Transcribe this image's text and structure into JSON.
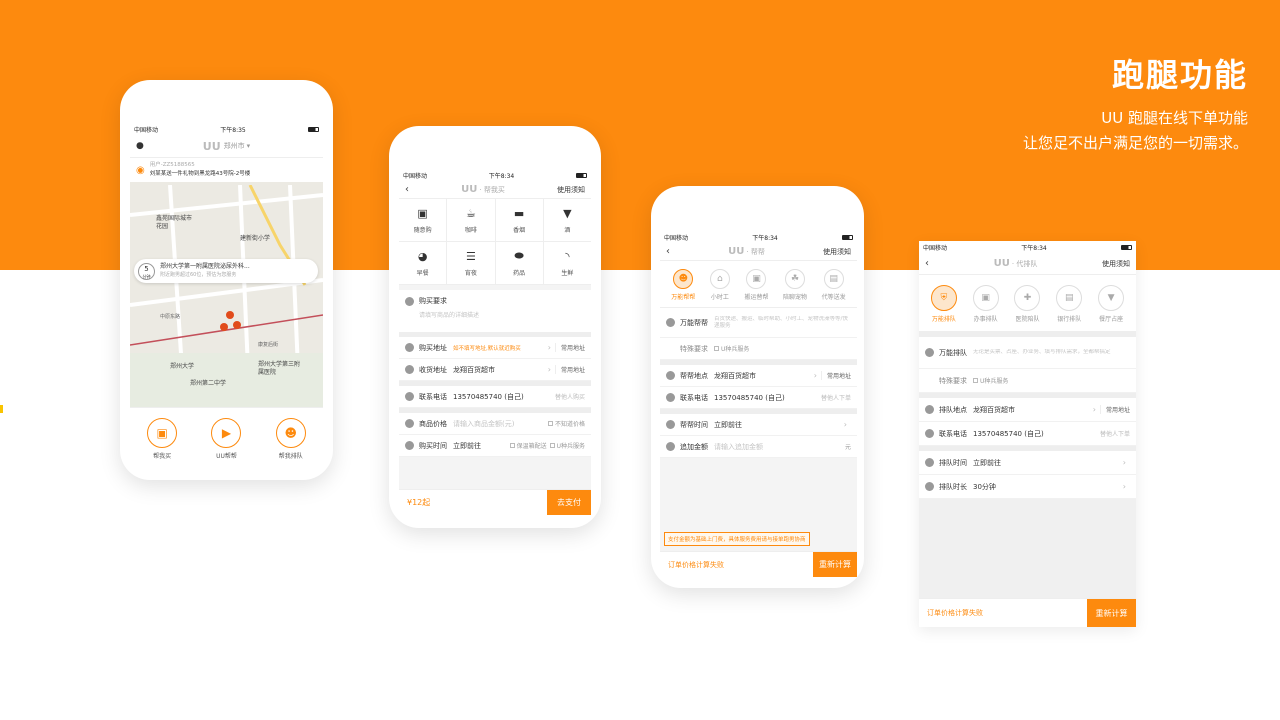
{
  "header": {
    "title": "跑腿功能",
    "line1": "UU 跑腿在线下单功能",
    "line2": "让您足不出户满足您的一切需求。"
  },
  "status": {
    "carrier": "中国移动",
    "time1": "下午8:35",
    "time2": "下午8:34",
    "time3": "下午8:34",
    "time4": "下午8:34"
  },
  "phone1": {
    "logo": "UU",
    "city": "郑州市",
    "user": "用户-ZZ5188565",
    "notice": "刘某某送一件礼物到黑龙路43号院-2号楼",
    "map_labels": [
      "鑫苑国际城市花园",
      "建新街小学",
      "郑州大学第一附属医院",
      "郑州大学",
      "郑州第二中学",
      "郑州大学第三附属医院",
      "中原东路",
      "康复后街"
    ],
    "eta_num": "5",
    "eta_unit": "分钟",
    "dest": "郑州大学第一附属医院泌尿外科...",
    "dest_sub": "附近跑男超过60位，预估为您服务",
    "tabs": [
      "帮我买",
      "UU帮帮",
      "帮我排队"
    ]
  },
  "phone2": {
    "title": "帮我买",
    "help": "使用须知",
    "cats": [
      "随意购",
      "咖啡",
      "香烟",
      "酒",
      "早餐",
      "宵夜",
      "药品",
      "生鲜"
    ],
    "req_label": "购买要求",
    "req_ph": "请填写商品的详细描述",
    "buy_addr_label": "购买地址",
    "buy_addr_val": "如不填写地址,默认就近购买",
    "common1": "常用地址",
    "recv_label": "收货地址",
    "recv_val": "龙翔百货超市",
    "common2": "常用地址",
    "phone_label": "联系电话",
    "phone_val": "13570485740 (自己)",
    "phone_side": "替他人购买",
    "price_label": "商品价格",
    "price_ph": "请输入商品金额(元)",
    "price_chk": "不知道价格",
    "time_label": "购买时间",
    "time_val": "立即前往",
    "chk1": "保温箱配送",
    "chk2": "U种兵服务",
    "total": "¥12起",
    "pay": "去支付"
  },
  "phone3": {
    "title": "帮帮",
    "help": "使用须知",
    "svcs": [
      "万能帮帮",
      "小时工",
      "搬运替帮",
      "陪聊宠物",
      "代等送发"
    ],
    "help_label": "万能帮帮",
    "help_ph": "百货快递、搬运、临时帮助、小时工、宠物洗澡等等/快递服务",
    "special_label": "特殊要求",
    "special_chk": "U种兵服务",
    "place_label": "帮帮地点",
    "place_val": "龙翔百货超市",
    "common": "常用地址",
    "phone_label": "联系电话",
    "phone_val": "13570485740 (自己)",
    "phone_side": "替他人下单",
    "time_label": "帮帮时间",
    "time_val": "立即前往",
    "extra_label": "追加金额",
    "extra_ph": "请输入追加金额",
    "extra_unit": "元",
    "notice": "支付金额为基础上门费，具体服务费用请与接单跑男协商",
    "fail": "订单价格计算失败",
    "retry": "重新计算"
  },
  "phone4": {
    "title": "代排队",
    "help": "使用须知",
    "svcs": [
      "万能排队",
      "办事排队",
      "医院陪队",
      "银行排队",
      "餐厅占座"
    ],
    "q_label": "万能排队",
    "q_ph": "无论是买票、占座、办业务、填写排队需求，全都帮搞定",
    "special_label": "特殊要求",
    "special_chk": "U种兵服务",
    "place_label": "排队地点",
    "place_val": "龙翔百货超市",
    "common": "常用地址",
    "phone_label": "联系电话",
    "phone_val": "13570485740 (自己)",
    "phone_side": "替他人下单",
    "time_label": "排队时间",
    "time_val": "立即前往",
    "dur_label": "排队时长",
    "dur_val": "30分钟",
    "fail": "订单价格计算失败",
    "retry": "重新计算"
  },
  "colors": {
    "accent": "#fd8a0e"
  }
}
